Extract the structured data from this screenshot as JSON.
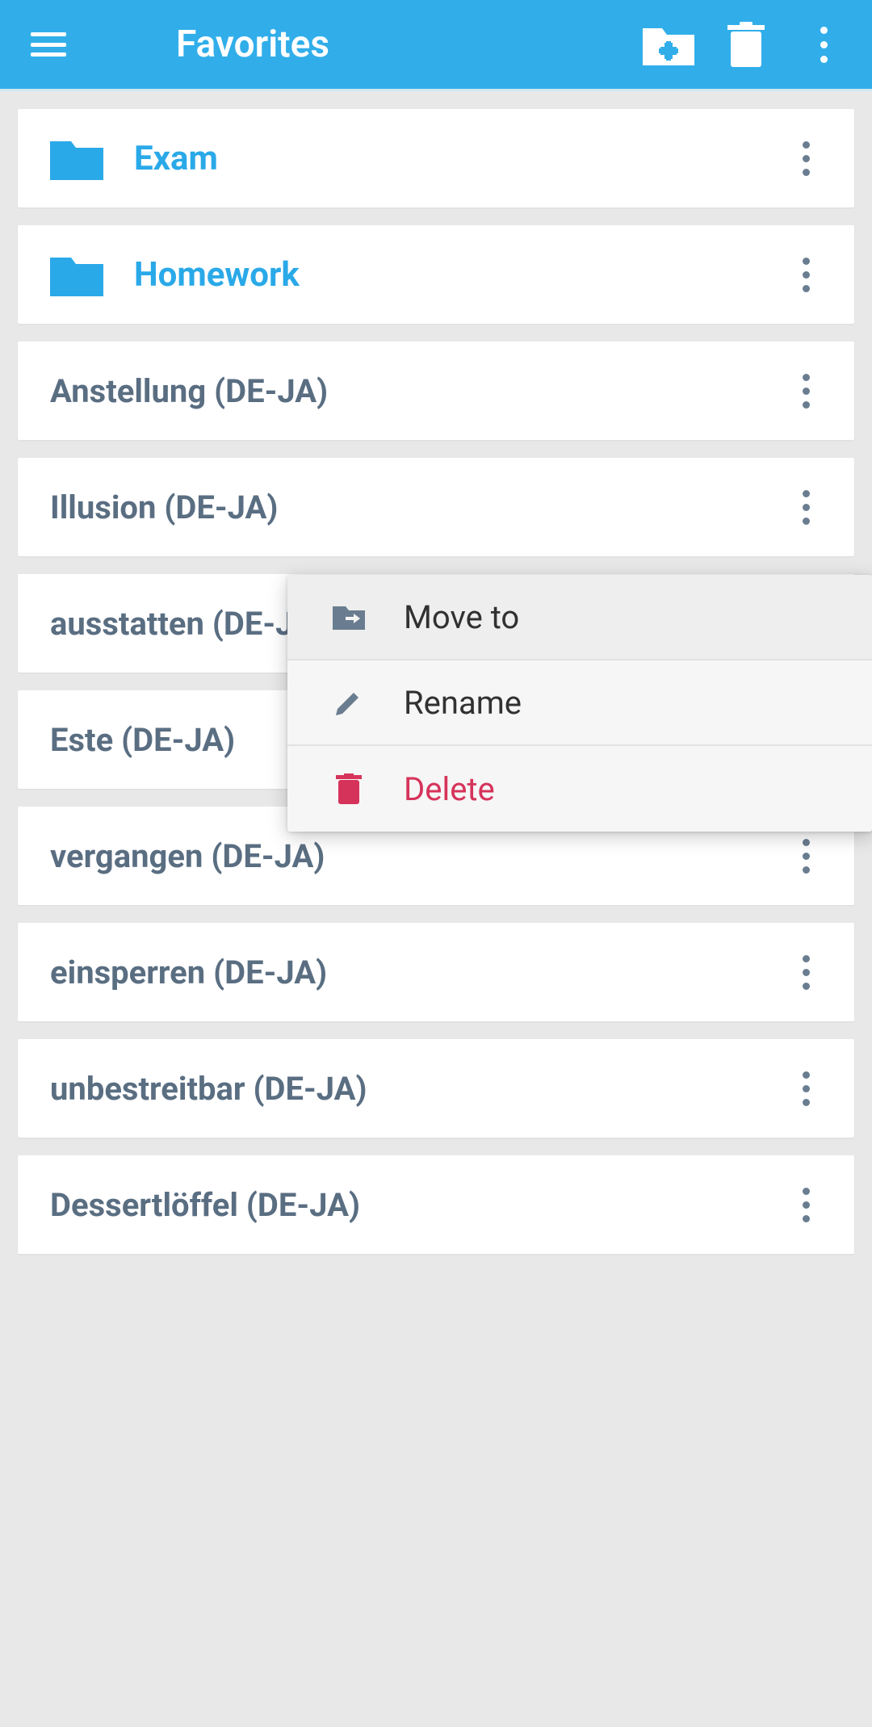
{
  "header": {
    "title": "Favorites"
  },
  "folders": [
    {
      "label": "Exam"
    },
    {
      "label": "Homework"
    }
  ],
  "items": [
    {
      "label": "Anstellung (DE-JA)"
    },
    {
      "label": "Illusion (DE-JA)"
    },
    {
      "label": "ausstatten (DE-JA)"
    },
    {
      "label": "Este (DE-JA)"
    },
    {
      "label": "vergangen (DE-JA)"
    },
    {
      "label": "einsperren (DE-JA)"
    },
    {
      "label": "unbestreitbar (DE-JA)"
    },
    {
      "label": "Dessertlöffel (DE-JA)"
    }
  ],
  "menu": {
    "move": "Move to",
    "rename": "Rename",
    "delete": "Delete"
  }
}
